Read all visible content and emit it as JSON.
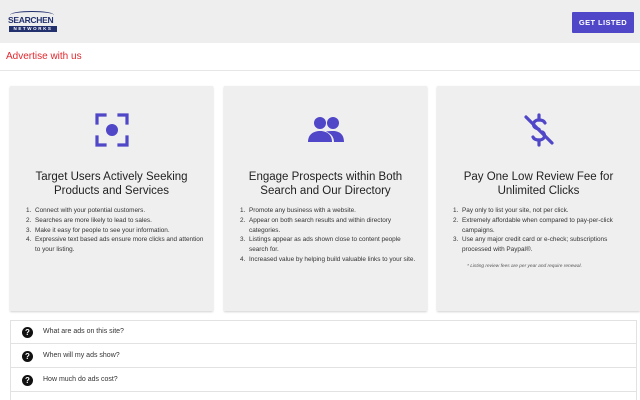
{
  "header": {
    "logo_main": "SEARCHEN",
    "logo_sub": "NETWORKS",
    "cta_label": "GET LISTED"
  },
  "page": {
    "section_title": "Advertise with us"
  },
  "cards": [
    {
      "icon": "target-focus-icon",
      "title": "Target Users Actively Seeking Products and Services",
      "items": [
        "Connect with your potential customers.",
        "Searches are more likely to lead to sales.",
        "Make it easy for people to see your information.",
        "Expressive text based ads ensure more clicks and attention to your listing."
      ]
    },
    {
      "icon": "people-group-icon",
      "title": "Engage Prospects within Both Search and Our Directory",
      "items": [
        "Promote any business with a website.",
        "Appear on both search results and within directory categories.",
        "Listings appear as ads shown close to content people search for.",
        "Increased value by helping build valuable links to your site."
      ]
    },
    {
      "icon": "no-money-icon",
      "title": "Pay One Low Review Fee for Unlimited Clicks",
      "items": [
        "Pay only to list your site, not per click.",
        "Extremely affordable when compared to pay-per-click campaigns.",
        "Use any major credit card or e-check; subscriptions processed with Paypal®."
      ],
      "footnote": "* Listing review fees are per year and require renewal."
    }
  ],
  "faq": {
    "icon": "question-circle-icon",
    "items": [
      "What are ads on this site?",
      "When will my ads show?",
      "How much do ads cost?"
    ]
  },
  "colors": {
    "accent": "#4f46c8",
    "section_title": "#e0282d",
    "header_bg": "#eeeeee",
    "card_bg": "#efefef"
  }
}
